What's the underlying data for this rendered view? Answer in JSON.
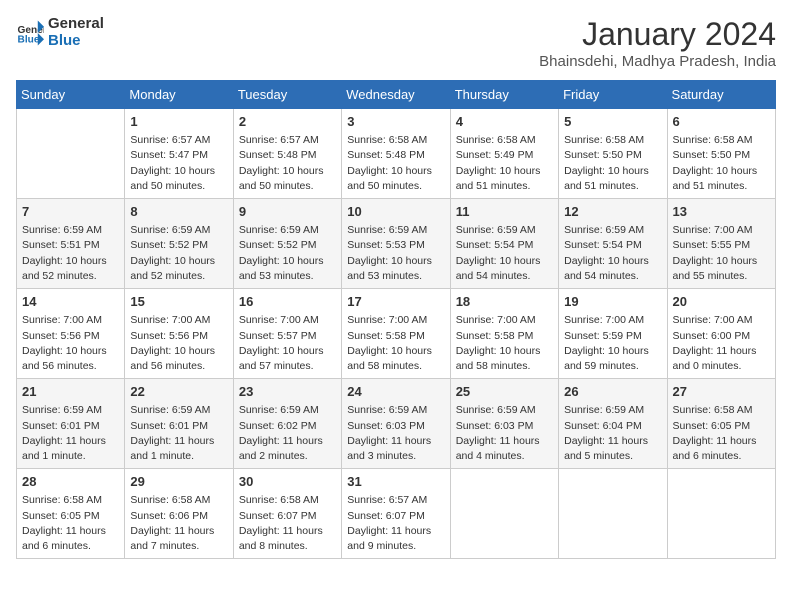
{
  "header": {
    "logo_line1": "General",
    "logo_line2": "Blue",
    "month": "January 2024",
    "location": "Bhainsdehi, Madhya Pradesh, India"
  },
  "weekdays": [
    "Sunday",
    "Monday",
    "Tuesday",
    "Wednesday",
    "Thursday",
    "Friday",
    "Saturday"
  ],
  "weeks": [
    [
      {
        "day": "",
        "info": ""
      },
      {
        "day": "1",
        "info": "Sunrise: 6:57 AM\nSunset: 5:47 PM\nDaylight: 10 hours\nand 50 minutes."
      },
      {
        "day": "2",
        "info": "Sunrise: 6:57 AM\nSunset: 5:48 PM\nDaylight: 10 hours\nand 50 minutes."
      },
      {
        "day": "3",
        "info": "Sunrise: 6:58 AM\nSunset: 5:48 PM\nDaylight: 10 hours\nand 50 minutes."
      },
      {
        "day": "4",
        "info": "Sunrise: 6:58 AM\nSunset: 5:49 PM\nDaylight: 10 hours\nand 51 minutes."
      },
      {
        "day": "5",
        "info": "Sunrise: 6:58 AM\nSunset: 5:50 PM\nDaylight: 10 hours\nand 51 minutes."
      },
      {
        "day": "6",
        "info": "Sunrise: 6:58 AM\nSunset: 5:50 PM\nDaylight: 10 hours\nand 51 minutes."
      }
    ],
    [
      {
        "day": "7",
        "info": "Sunrise: 6:59 AM\nSunset: 5:51 PM\nDaylight: 10 hours\nand 52 minutes."
      },
      {
        "day": "8",
        "info": "Sunrise: 6:59 AM\nSunset: 5:52 PM\nDaylight: 10 hours\nand 52 minutes."
      },
      {
        "day": "9",
        "info": "Sunrise: 6:59 AM\nSunset: 5:52 PM\nDaylight: 10 hours\nand 53 minutes."
      },
      {
        "day": "10",
        "info": "Sunrise: 6:59 AM\nSunset: 5:53 PM\nDaylight: 10 hours\nand 53 minutes."
      },
      {
        "day": "11",
        "info": "Sunrise: 6:59 AM\nSunset: 5:54 PM\nDaylight: 10 hours\nand 54 minutes."
      },
      {
        "day": "12",
        "info": "Sunrise: 6:59 AM\nSunset: 5:54 PM\nDaylight: 10 hours\nand 54 minutes."
      },
      {
        "day": "13",
        "info": "Sunrise: 7:00 AM\nSunset: 5:55 PM\nDaylight: 10 hours\nand 55 minutes."
      }
    ],
    [
      {
        "day": "14",
        "info": "Sunrise: 7:00 AM\nSunset: 5:56 PM\nDaylight: 10 hours\nand 56 minutes."
      },
      {
        "day": "15",
        "info": "Sunrise: 7:00 AM\nSunset: 5:56 PM\nDaylight: 10 hours\nand 56 minutes."
      },
      {
        "day": "16",
        "info": "Sunrise: 7:00 AM\nSunset: 5:57 PM\nDaylight: 10 hours\nand 57 minutes."
      },
      {
        "day": "17",
        "info": "Sunrise: 7:00 AM\nSunset: 5:58 PM\nDaylight: 10 hours\nand 58 minutes."
      },
      {
        "day": "18",
        "info": "Sunrise: 7:00 AM\nSunset: 5:58 PM\nDaylight: 10 hours\nand 58 minutes."
      },
      {
        "day": "19",
        "info": "Sunrise: 7:00 AM\nSunset: 5:59 PM\nDaylight: 10 hours\nand 59 minutes."
      },
      {
        "day": "20",
        "info": "Sunrise: 7:00 AM\nSunset: 6:00 PM\nDaylight: 11 hours\nand 0 minutes."
      }
    ],
    [
      {
        "day": "21",
        "info": "Sunrise: 6:59 AM\nSunset: 6:01 PM\nDaylight: 11 hours\nand 1 minute."
      },
      {
        "day": "22",
        "info": "Sunrise: 6:59 AM\nSunset: 6:01 PM\nDaylight: 11 hours\nand 1 minute."
      },
      {
        "day": "23",
        "info": "Sunrise: 6:59 AM\nSunset: 6:02 PM\nDaylight: 11 hours\nand 2 minutes."
      },
      {
        "day": "24",
        "info": "Sunrise: 6:59 AM\nSunset: 6:03 PM\nDaylight: 11 hours\nand 3 minutes."
      },
      {
        "day": "25",
        "info": "Sunrise: 6:59 AM\nSunset: 6:03 PM\nDaylight: 11 hours\nand 4 minutes."
      },
      {
        "day": "26",
        "info": "Sunrise: 6:59 AM\nSunset: 6:04 PM\nDaylight: 11 hours\nand 5 minutes."
      },
      {
        "day": "27",
        "info": "Sunrise: 6:58 AM\nSunset: 6:05 PM\nDaylight: 11 hours\nand 6 minutes."
      }
    ],
    [
      {
        "day": "28",
        "info": "Sunrise: 6:58 AM\nSunset: 6:05 PM\nDaylight: 11 hours\nand 6 minutes."
      },
      {
        "day": "29",
        "info": "Sunrise: 6:58 AM\nSunset: 6:06 PM\nDaylight: 11 hours\nand 7 minutes."
      },
      {
        "day": "30",
        "info": "Sunrise: 6:58 AM\nSunset: 6:07 PM\nDaylight: 11 hours\nand 8 minutes."
      },
      {
        "day": "31",
        "info": "Sunrise: 6:57 AM\nSunset: 6:07 PM\nDaylight: 11 hours\nand 9 minutes."
      },
      {
        "day": "",
        "info": ""
      },
      {
        "day": "",
        "info": ""
      },
      {
        "day": "",
        "info": ""
      }
    ]
  ]
}
